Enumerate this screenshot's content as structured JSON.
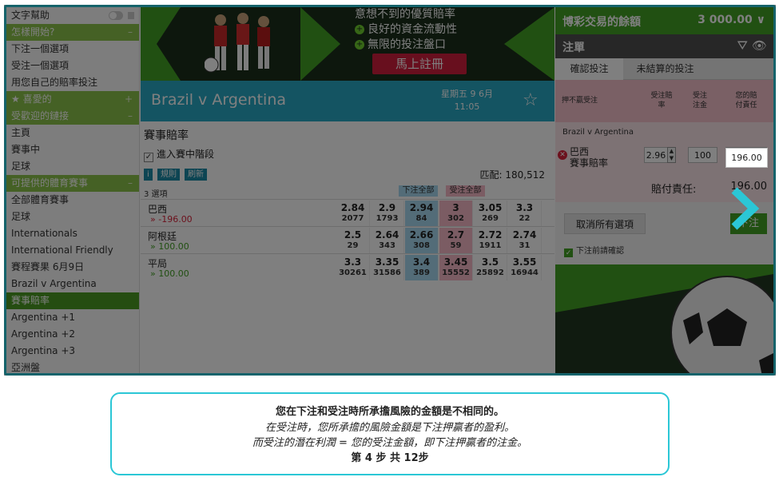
{
  "sidebar": {
    "items": [
      {
        "label": "文字幫助",
        "type": "toggle"
      },
      {
        "label": "怎樣開始?",
        "type": "head",
        "sign": "–"
      },
      {
        "label": "下注一個選項"
      },
      {
        "label": "受注一個選項"
      },
      {
        "label": "用您自己的賠率投注"
      },
      {
        "label": "喜愛的",
        "type": "head",
        "sign": "+"
      },
      {
        "label": "受歡迎的鏈接",
        "type": "head",
        "sign": "–"
      },
      {
        "label": "主頁"
      },
      {
        "label": "賽事中"
      },
      {
        "label": "足球"
      },
      {
        "label": "可提供的體育賽事",
        "type": "head",
        "sign": "–"
      },
      {
        "label": "全部體育賽事"
      },
      {
        "label": "足球"
      },
      {
        "label": "Internationals"
      },
      {
        "label": "International Friendly"
      },
      {
        "label": "賽程賽果 6月9日"
      },
      {
        "label": "Brazil v Argentina"
      },
      {
        "label": "賽事賠率",
        "type": "headdark"
      },
      {
        "label": "Argentina +1"
      },
      {
        "label": "Argentina +2"
      },
      {
        "label": "Argentina +3"
      },
      {
        "label": "亞洲盤"
      }
    ]
  },
  "banner": {
    "line1": "意想不到的優質賠率",
    "line2": "良好的資金流動性",
    "line3": "無限的投注盤口",
    "cta": "馬上註冊"
  },
  "event": {
    "title": "Brazil v Argentina",
    "date": "星期五 9 6月",
    "time": "11:05"
  },
  "market": {
    "title": "賽事賠率",
    "inplay": "進入賽中階段",
    "rules": "規則",
    "rules_icon": "i",
    "refresh": "刷新",
    "matched": "匹配: 180,512",
    "selections": "3 選項",
    "back_all": "下注全部",
    "lay_all": "受注全部",
    "runners": [
      {
        "name": "巴西",
        "pl": "» -196.00",
        "pl_color": "#d9233a",
        "odds": [
          [
            "2.84",
            "2077"
          ],
          [
            "2.9",
            "1793"
          ],
          [
            "2.94",
            "84"
          ],
          [
            "3",
            "302"
          ],
          [
            "3.05",
            "269"
          ],
          [
            "3.3",
            "22"
          ]
        ]
      },
      {
        "name": "阿根廷",
        "pl": "» 100.00",
        "pl_color": "#43a025",
        "odds": [
          [
            "2.5",
            "29"
          ],
          [
            "2.64",
            "343"
          ],
          [
            "2.66",
            "308"
          ],
          [
            "2.7",
            "59"
          ],
          [
            "2.72",
            "1911"
          ],
          [
            "2.74",
            "31"
          ]
        ]
      },
      {
        "name": "平局",
        "pl": "» 100.00",
        "pl_color": "#43a025",
        "odds": [
          [
            "3.3",
            "30261"
          ],
          [
            "3.35",
            "31586"
          ],
          [
            "3.4",
            "389"
          ],
          [
            "3.45",
            "15552"
          ],
          [
            "3.5",
            "25892"
          ],
          [
            "3.55",
            "16944"
          ]
        ]
      }
    ]
  },
  "betslip": {
    "balance_label": "博彩交易的餘額",
    "balance_value": "3 000.00 ∨",
    "title": "注單",
    "tab_open": "確認投注",
    "tab_unmatched": "未結算的投注",
    "lay_title": "押不贏受注",
    "col_odds": "受注賠率",
    "col_stake": "受注注金",
    "col_liability": "您的賠付責任",
    "event": "Brazil v Argentina",
    "sel_name": "巴西",
    "sel_market": "賽事賠率",
    "odds": "2.96",
    "stake": "100",
    "liability_input": "196.00",
    "liability_label": "賠付責任:",
    "liability_value": "196.00",
    "cancel_all": "取消所有選項",
    "place": "下注",
    "confirm": "下注前請確認"
  },
  "tooltip": {
    "line1": "您在下注和受注時所承擔風險的金額是不相同的。",
    "line2": "在受注時，您所承擔的風險金額是下注押贏者的盈利。",
    "line3": "而受注的潛在利潤 = 您的受注金額，即下注押贏者的注金。",
    "step_prefix": "第",
    "step": "4",
    "step_mid": "步 共",
    "total": "12",
    "step_suffix": "步"
  },
  "colors": {
    "accent": "#2bc7d6",
    "green": "#43a025",
    "blue": "#29a8c4",
    "lay": "#f6b8c6",
    "back": "#a6d8f0"
  }
}
